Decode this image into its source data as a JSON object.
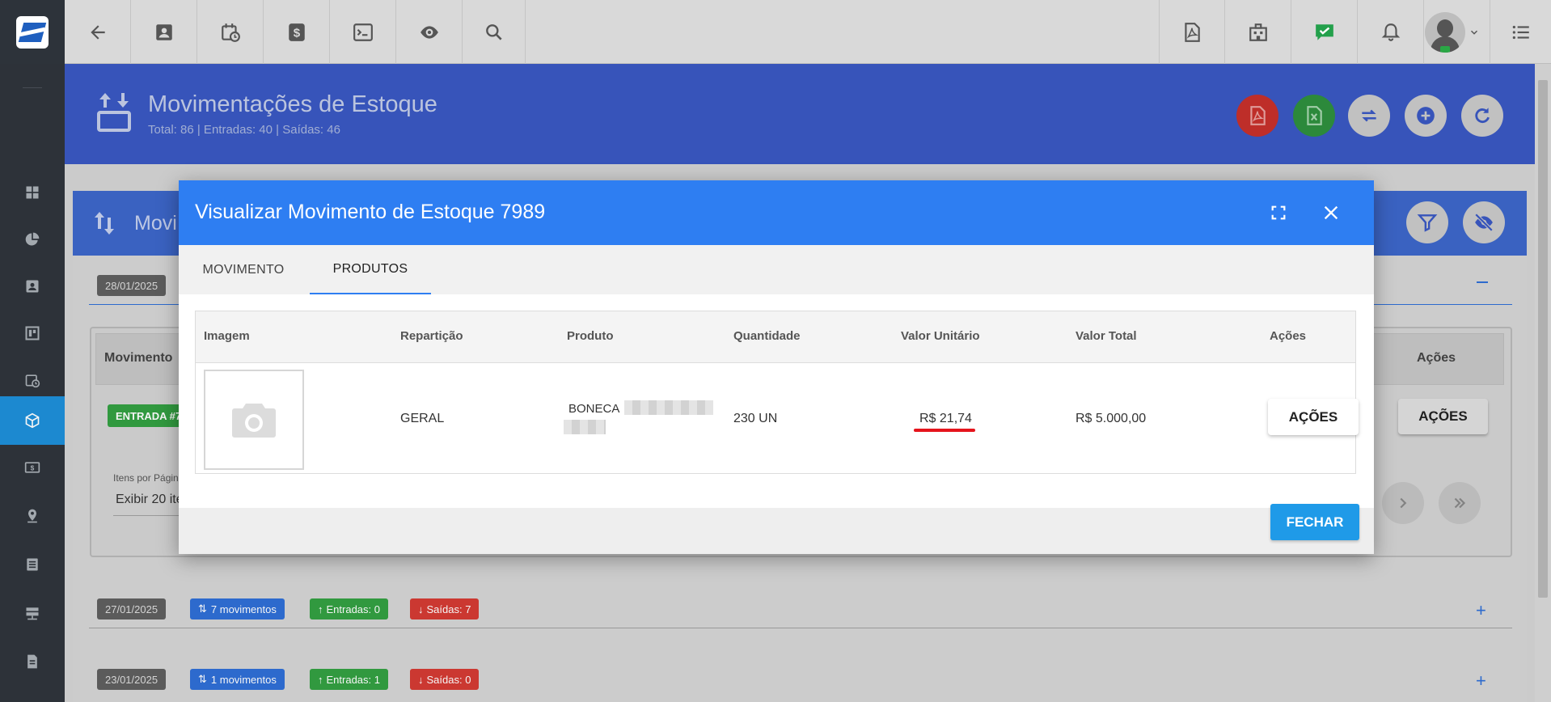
{
  "topbar": {
    "icons": [
      "logo-icon",
      "back-arrow-icon",
      "contact-card-icon",
      "calendar-clock-icon",
      "dollar-icon",
      "terminal-icon",
      "eye-icon",
      "search-icon",
      "pdf-icon",
      "building-icon",
      "chat-check-icon",
      "bell-icon",
      "avatar",
      "menu-list-icon"
    ]
  },
  "sidebar": {
    "items": [
      "dashboard-icon",
      "pie-chart-icon",
      "contact-card-icon",
      "board-icon",
      "calendar-clock-icon",
      "calendar-grid-icon",
      "box-icon",
      "money-icon",
      "location-pin-icon",
      "list-icon",
      "server-icon",
      "document-icon"
    ],
    "active_index": 6
  },
  "page_header": {
    "title": "Movimentações de Estoque",
    "subtitle": "Total: 86 | Entradas: 40 | Saídas: 46"
  },
  "background": {
    "card_title": "Movi",
    "group1": {
      "date": "28/01/2025"
    },
    "table_col_movimento": "Movimento",
    "table_col_acoes": "Ações",
    "entrada_badge": "ENTRADA #7",
    "acoes_label": "AÇÕES",
    "items_per_page_label": "Itens por Págin",
    "items_per_page_value": "Exibir 20 ite",
    "group2": {
      "date": "27/01/2025",
      "moves": "7 movimentos",
      "entradas": "Entradas: 0",
      "saidas": "Saídas: 7"
    },
    "group3": {
      "date": "23/01/2025",
      "moves": "1 movimentos",
      "entradas": "Entradas: 1",
      "saidas": "Saídas: 0"
    }
  },
  "modal": {
    "title": "Visualizar Movimento de Estoque 7989",
    "tabs": [
      "MOVIMENTO",
      "PRODUTOS"
    ],
    "active_tab": "PRODUTOS",
    "columns": [
      "Imagem",
      "Repartição",
      "Produto",
      "Quantidade",
      "Valor Unitário",
      "Valor Total",
      "Ações"
    ],
    "row": {
      "reparticao": "GERAL",
      "produto": "BONECA",
      "quantidade": "230 UN",
      "valor_unitario": "R$ 21,74",
      "valor_total": "R$ 5.000,00",
      "acoes": "AÇÕES"
    },
    "close_button": "FECHAR"
  },
  "colors": {
    "accent": "#2e7ef2",
    "header_blue": "#3a58c2",
    "sidebar": "#2f353c",
    "highlight_underline": "#e5141c",
    "fechar": "#1f9ae8"
  }
}
